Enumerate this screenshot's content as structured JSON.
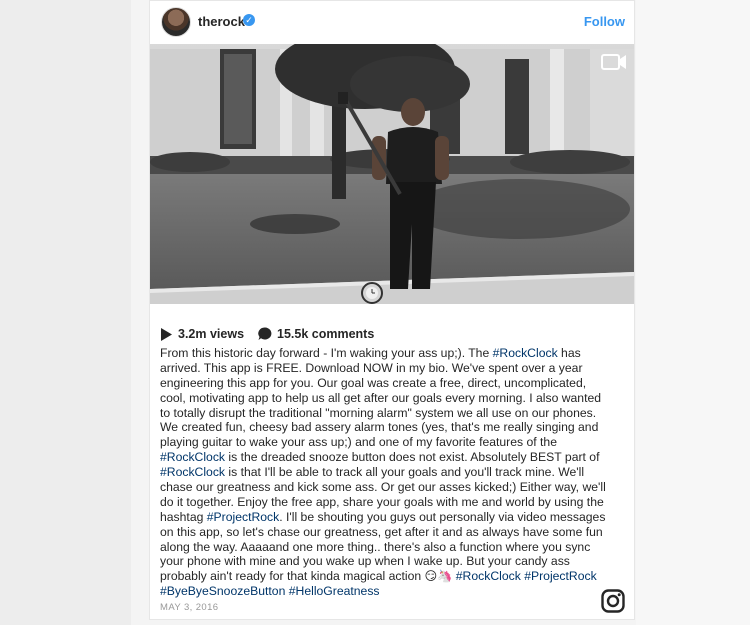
{
  "post": {
    "username": "therock",
    "verified_mark": "✓",
    "follow_label": "Follow",
    "views": "3.2m views",
    "comments": "15.5k comments",
    "caption_lines": [
      [
        {
          "t": "From this historic day forward - I'm waking your ass up;). The "
        },
        {
          "t": "#RockClock",
          "tag": true
        },
        {
          "t": " has"
        }
      ],
      [
        {
          "t": "arrived. This app is FREE. Download NOW in my bio. We've spent over a year"
        }
      ],
      [
        {
          "t": "engineering this app for you. Our goal was create a free, direct, uncomplicated,"
        }
      ],
      [
        {
          "t": "cool, motivating app to help us all get after our goals every morning. I also wanted"
        }
      ],
      [
        {
          "t": "to totally disrupt the traditional \"morning alarm\" system we all use on our phones."
        }
      ],
      [
        {
          "t": "We created fun, cheesy bad assery alarm tones (yes, that's me really singing and"
        }
      ],
      [
        {
          "t": "playing guitar to wake your ass up;) and one of my favorite features of the"
        }
      ],
      [
        {
          "t": "#RockClock",
          "tag": true
        },
        {
          "t": " is the dreaded snooze button does not exist. Absolutely BEST part of"
        }
      ],
      [
        {
          "t": "#RockClock",
          "tag": true
        },
        {
          "t": " is that I'll be able to track all your goals and you'll track mine. We'll"
        }
      ],
      [
        {
          "t": "chase our greatness and kick some ass. Or get our asses kicked;) Either way, we'll"
        }
      ],
      [
        {
          "t": "do it together. Enjoy the free app, share your goals with me and world by using the"
        }
      ],
      [
        {
          "t": "hashtag "
        },
        {
          "t": "#ProjectRock",
          "tag": true
        },
        {
          "t": ". I'll be shouting you guys out personally via video messages"
        }
      ],
      [
        {
          "t": "on this app, so let's chase our greatness, get after it and as always have some fun"
        }
      ],
      [
        {
          "t": "along the way. Aaaaand one more thing.. there's also a function where you sync"
        }
      ],
      [
        {
          "t": "your phone with mine and you wake up when I wake up. But your candy ass"
        }
      ],
      [
        {
          "t": "probably ain't ready for that kinda magical action 😏🦄 "
        },
        {
          "t": "#RockClock",
          "tag": true
        },
        {
          "t": " "
        },
        {
          "t": "#ProjectRock",
          "tag": true
        }
      ],
      [
        {
          "t": "#ByeByeSnoozeButton",
          "tag": true
        },
        {
          "t": " "
        },
        {
          "t": "#HelloGreatness",
          "tag": true
        }
      ]
    ],
    "date": "MAY 3, 2016"
  },
  "icons": {
    "video": "video-camera-icon",
    "play": "play-icon",
    "comment": "comment-bubble-icon",
    "instagram": "instagram-logo-icon"
  },
  "colors": {
    "link_blue": "#3897f0",
    "hashtag": "#003569",
    "text": "#262626",
    "muted": "#999999"
  }
}
